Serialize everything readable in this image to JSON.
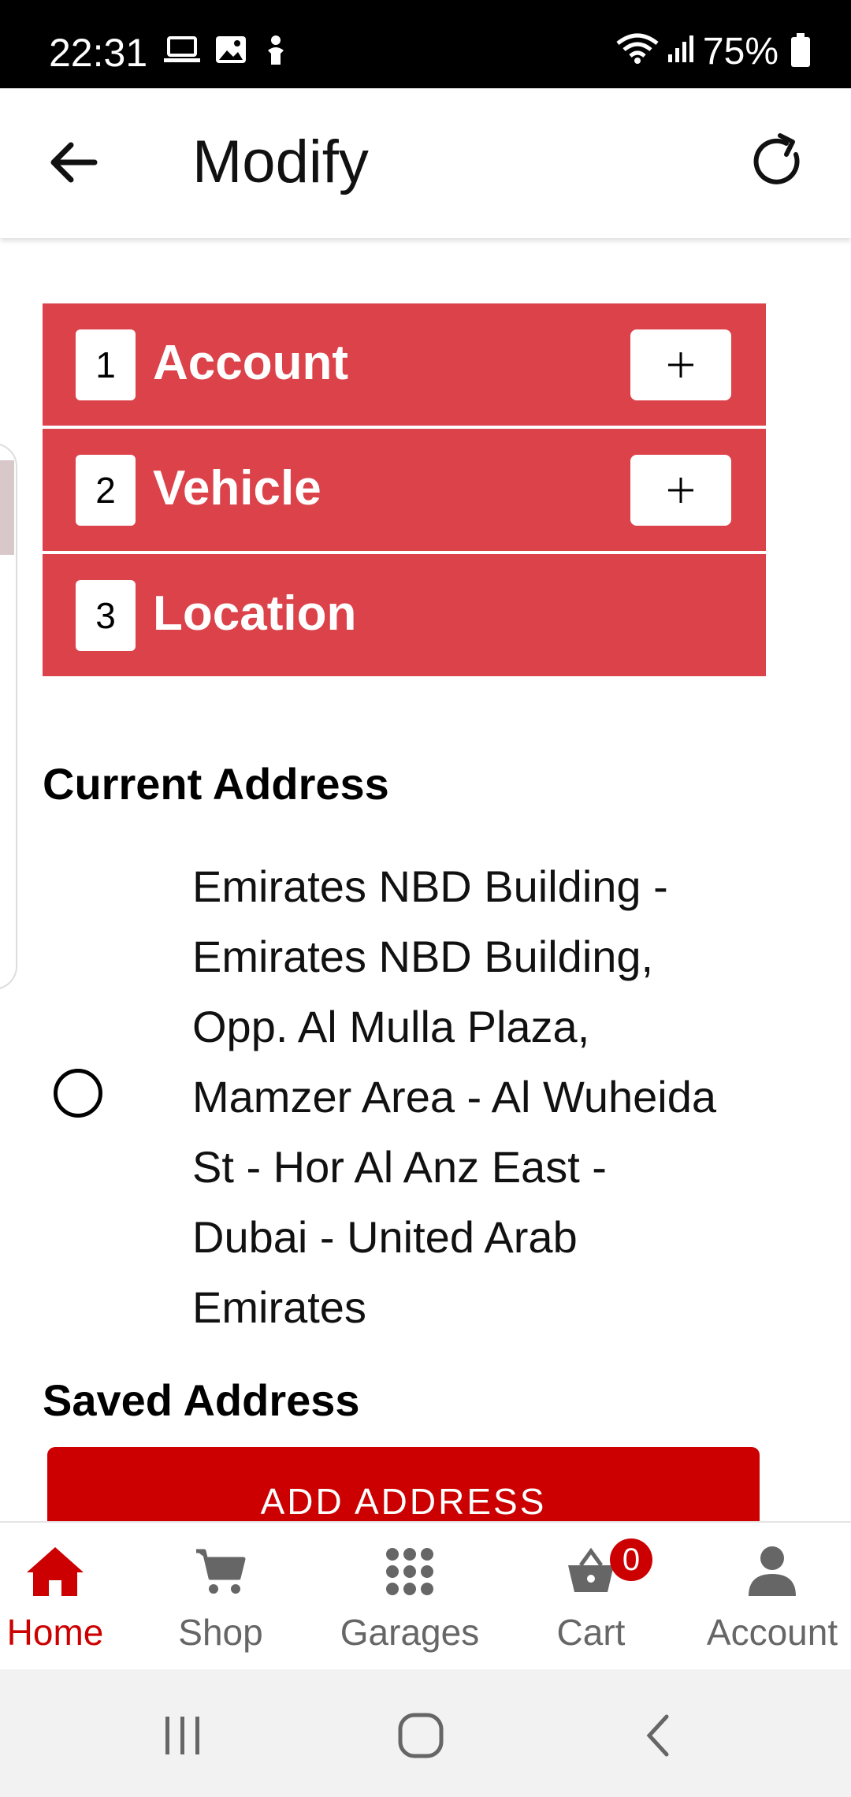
{
  "status_bar": {
    "time": "22:31",
    "battery": "75%",
    "icons": [
      "laptop-icon",
      "image-icon",
      "accessibility-icon",
      "wifi-icon",
      "signal-icon",
      "battery-icon"
    ]
  },
  "header": {
    "title": "Modify",
    "back_icon": "arrow-left-icon",
    "refresh_icon": "refresh-icon"
  },
  "steps": [
    {
      "number": "1",
      "label": "Account",
      "expand_symbol": "+"
    },
    {
      "number": "2",
      "label": "Vehicle",
      "expand_symbol": "+"
    },
    {
      "number": "3",
      "label": "Location"
    }
  ],
  "current_address": {
    "heading": "Current Address",
    "text": "Emirates NBD Building - Emirates NBD Building, Opp. Al Mulla Plaza, Mamzer Area - Al Wuheida St - Hor Al Anz East - Dubai - United Arab Emirates"
  },
  "saved_address": {
    "heading": "Saved Address",
    "add_button_label": "ADD ADDRESS"
  },
  "bottom_nav": {
    "items": [
      {
        "label": "Home",
        "icon": "home-icon",
        "active": true
      },
      {
        "label": "Shop",
        "icon": "cart-icon"
      },
      {
        "label": "Garages",
        "icon": "grid-icon"
      },
      {
        "label": "Cart",
        "icon": "basket-icon",
        "badge": "0"
      },
      {
        "label": "Account",
        "icon": "user-icon"
      }
    ]
  },
  "colors": {
    "step_bg": "#db424a",
    "accent": "#cc0000",
    "nav_inactive": "#666666"
  }
}
